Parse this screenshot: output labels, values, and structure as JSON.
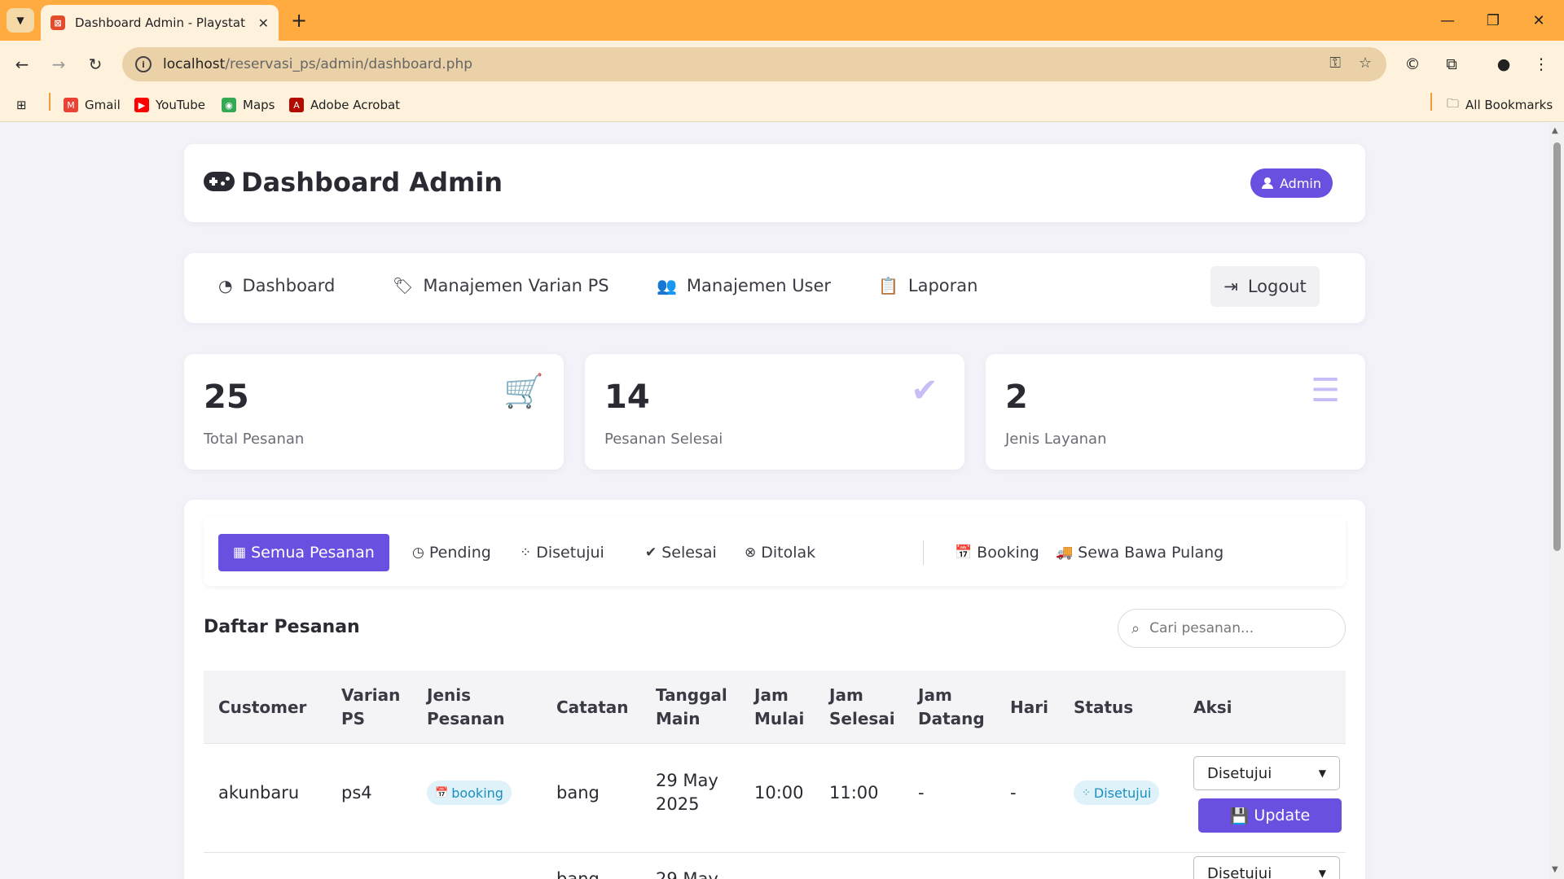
{
  "browser": {
    "tab_title": "Dashboard Admin - Playstation",
    "url_host": "localhost",
    "url_path": "/reservasi_ps/admin/dashboard.php",
    "bookmarks": [
      "Gmail",
      "YouTube",
      "Maps",
      "Adobe Acrobat"
    ],
    "all_bookmarks": "All Bookmarks"
  },
  "header": {
    "title": "Dashboard Admin",
    "badge": "Admin"
  },
  "nav": {
    "items": [
      "Dashboard",
      "Manajemen Varian PS",
      "Manajemen User",
      "Laporan"
    ],
    "logout": "Logout"
  },
  "stats": [
    {
      "value": "25",
      "label": "Total Pesanan",
      "icon": "cart-icon"
    },
    {
      "value": "14",
      "label": "Pesanan Selesai",
      "icon": "check-circle-icon"
    },
    {
      "value": "2",
      "label": "Jenis Layanan",
      "icon": "list-icon"
    }
  ],
  "filters": [
    "Semua Pesanan",
    "Pending",
    "Disetujui",
    "Selesai",
    "Ditolak",
    "Booking",
    "Sewa Bawa Pulang"
  ],
  "list": {
    "title": "Daftar Pesanan",
    "search_placeholder": "Cari pesanan..."
  },
  "table": {
    "columns": [
      "Customer",
      "Varian PS",
      "Jenis Pesanan",
      "Catatan",
      "Tanggal Main",
      "Jam Mulai",
      "Jam Selesai",
      "Jam Datang",
      "Hari",
      "Status",
      "Aksi"
    ],
    "rows": [
      {
        "customer": "akunbaru",
        "varian": "ps4",
        "jenis": "booking",
        "catatan": "bang",
        "tanggal": "29 May 2025",
        "jam_mulai": "10:00",
        "jam_selesai": "11:00",
        "jam_datang": "-",
        "hari": "-",
        "status": "Disetujui",
        "aksi_select": "Disetujui",
        "aksi_button": "Update"
      },
      {
        "customer": "",
        "varian": "",
        "jenis": "",
        "catatan": "bang",
        "tanggal": "29 May",
        "jam_mulai": "",
        "jam_selesai": "",
        "jam_datang": "",
        "hari": "",
        "status": "",
        "aksi_select": "Disetujui",
        "aksi_button": ""
      }
    ]
  },
  "colors": {
    "accent": "#6b4fe0",
    "browser_frame": "#ffab40",
    "badge_bg": "#dff1f9",
    "badge_text": "#1a8fc0"
  }
}
